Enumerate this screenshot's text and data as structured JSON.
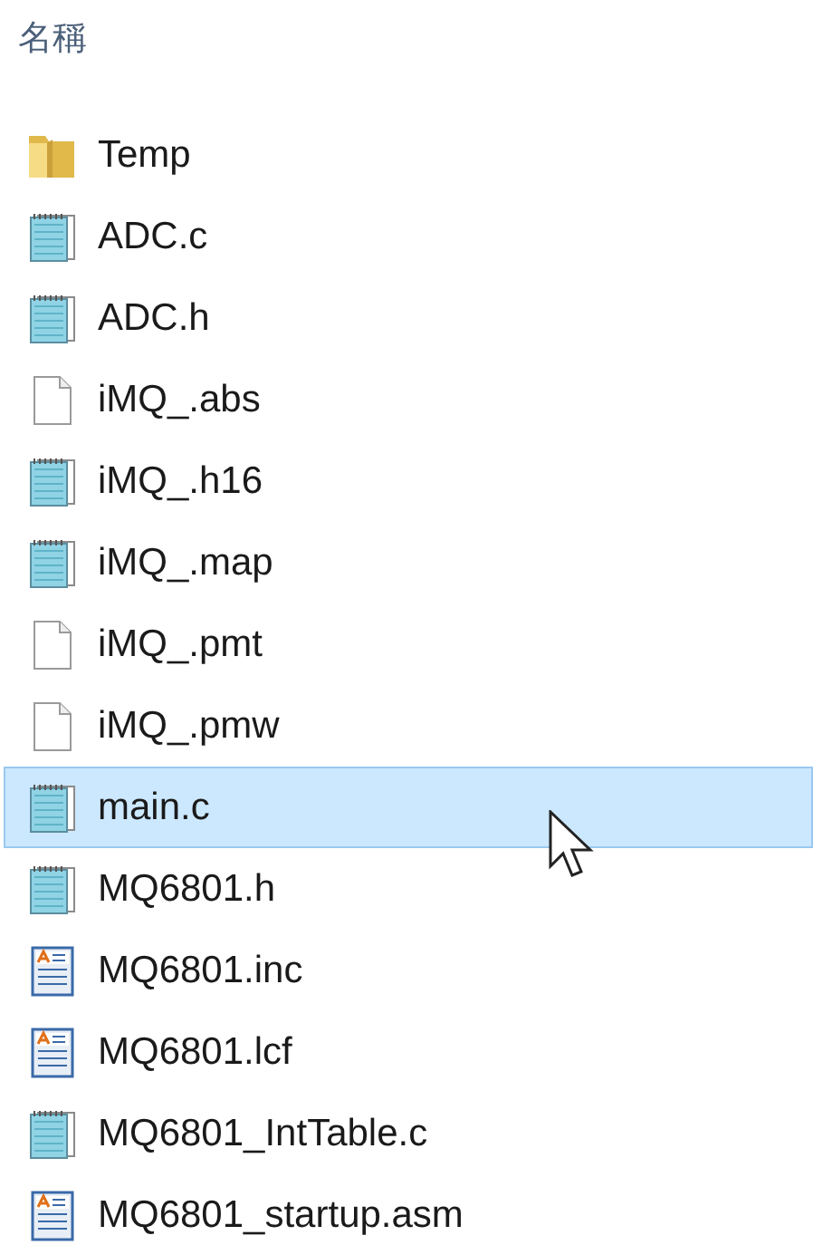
{
  "column_header": "名稱",
  "files": [
    {
      "name": "Temp",
      "kind": "folder",
      "selected": false
    },
    {
      "name": "ADC.c",
      "kind": "notepad",
      "selected": false
    },
    {
      "name": "ADC.h",
      "kind": "notepad",
      "selected": false
    },
    {
      "name": "iMQ_.abs",
      "kind": "blank",
      "selected": false
    },
    {
      "name": "iMQ_.h16",
      "kind": "notepad",
      "selected": false
    },
    {
      "name": "iMQ_.map",
      "kind": "notepad",
      "selected": false
    },
    {
      "name": "iMQ_.pmt",
      "kind": "blank",
      "selected": false
    },
    {
      "name": "iMQ_.pmw",
      "kind": "blank",
      "selected": false
    },
    {
      "name": "main.c",
      "kind": "notepad",
      "selected": true
    },
    {
      "name": "MQ6801.h",
      "kind": "notepad",
      "selected": false
    },
    {
      "name": "MQ6801.inc",
      "kind": "config",
      "selected": false
    },
    {
      "name": "MQ6801.lcf",
      "kind": "config",
      "selected": false
    },
    {
      "name": "MQ6801_IntTable.c",
      "kind": "notepad",
      "selected": false
    },
    {
      "name": "MQ6801_startup.asm",
      "kind": "config",
      "selected": false
    }
  ]
}
